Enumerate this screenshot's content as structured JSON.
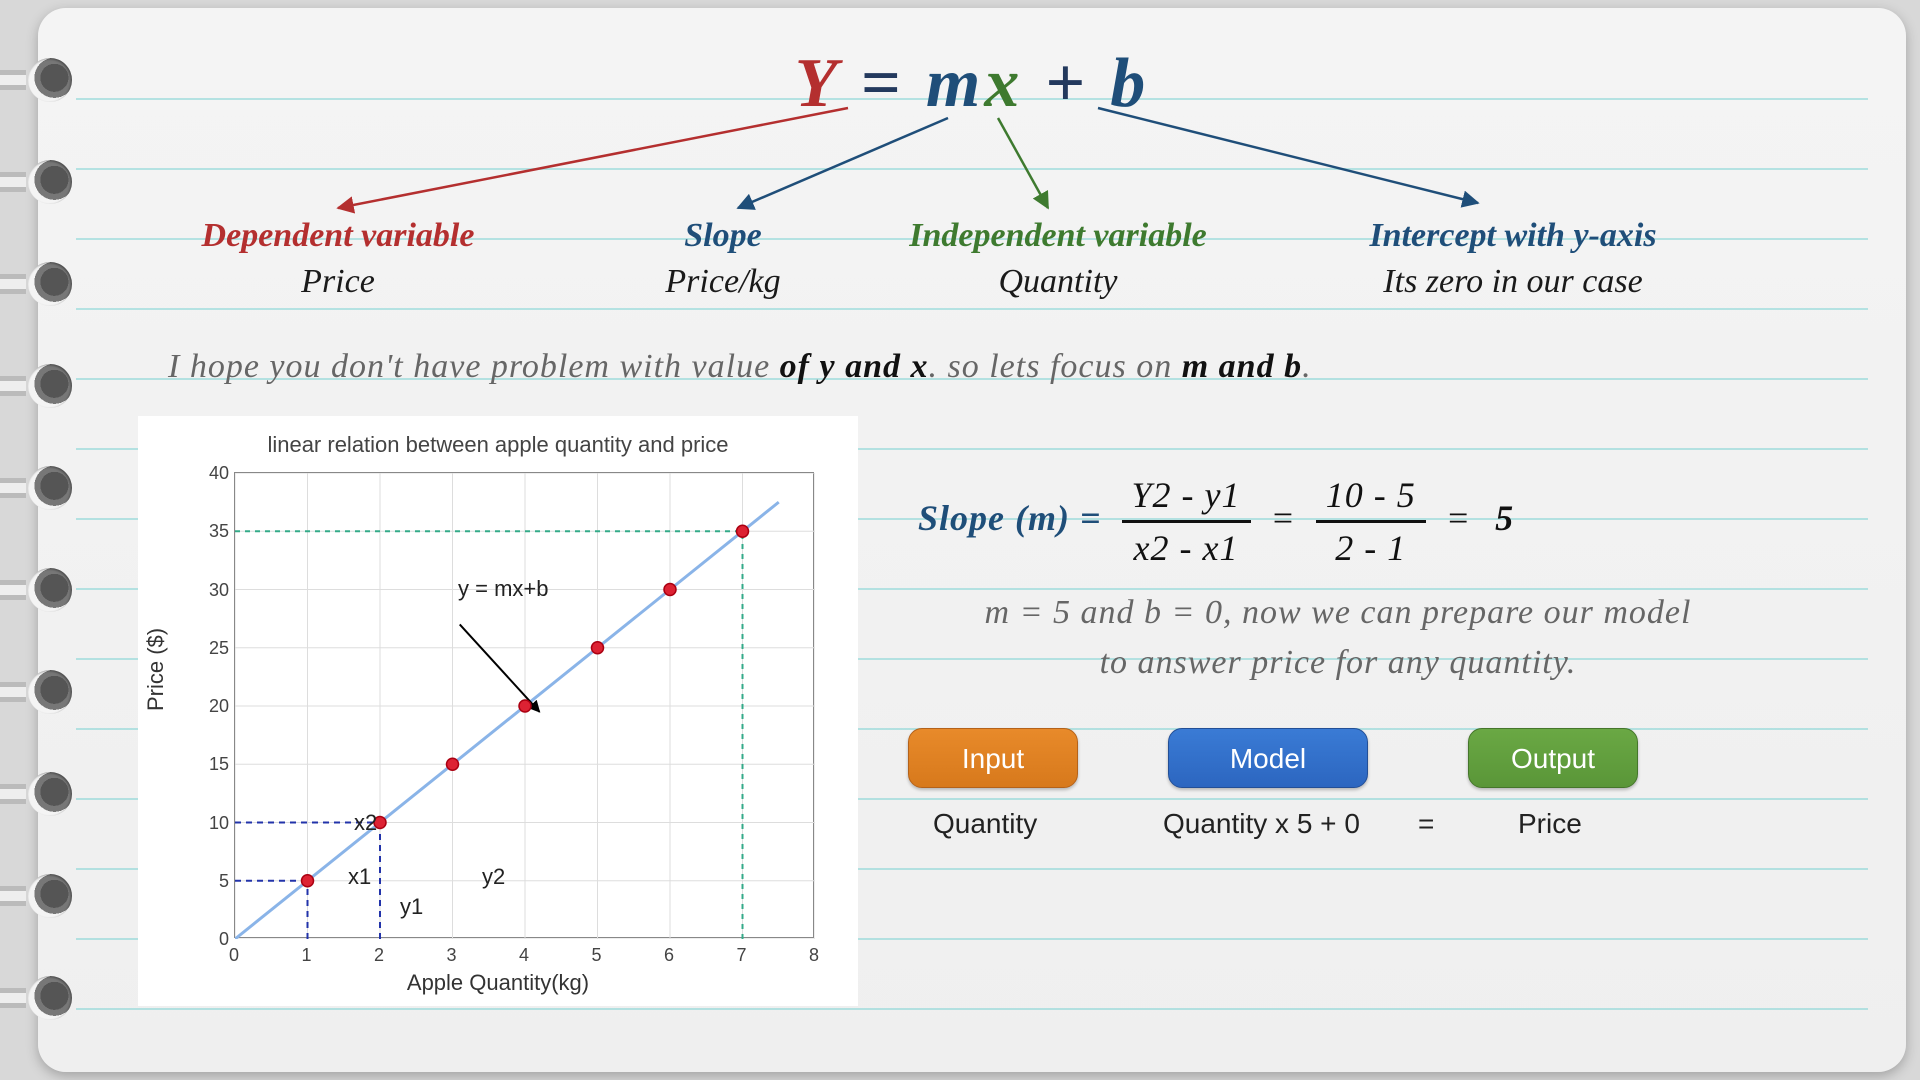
{
  "equation": {
    "y": "Y",
    "eq": " = ",
    "m": "m",
    "x": "x",
    "plus": " + ",
    "b": "b"
  },
  "definitions": {
    "dependent": {
      "title": "Dependent variable",
      "sub": "Price",
      "color": "#b42f2f"
    },
    "slope": {
      "title": "Slope",
      "sub": "Price/kg",
      "color": "#1f4e79"
    },
    "independent": {
      "title": "Independent variable",
      "sub": "Quantity",
      "color": "#3e7a2f"
    },
    "intercept": {
      "title": "Intercept with y-axis",
      "sub": "Its zero in our case",
      "color": "#1f4e79"
    }
  },
  "intro_line": {
    "pre": "I hope you don't have problem with value ",
    "em1": "of y and x",
    "mid": ". so lets focus on ",
    "em2": "m and b",
    "post": "."
  },
  "chart_data": {
    "type": "scatter-line",
    "title": "linear relation between apple quantity and price",
    "xlabel": "Apple Quantity(kg)",
    "ylabel": "Price ($)",
    "xlim": [
      0,
      8
    ],
    "ylim": [
      0,
      40
    ],
    "xticks": [
      0,
      1,
      2,
      3,
      4,
      5,
      6,
      7,
      8
    ],
    "yticks": [
      0,
      5,
      10,
      15,
      20,
      25,
      30,
      35,
      40
    ],
    "x": [
      1,
      2,
      3,
      4,
      5,
      6,
      7
    ],
    "y": [
      5,
      10,
      15,
      20,
      25,
      30,
      35
    ],
    "line_label": "y = mx+b",
    "marked": {
      "x1": 1,
      "y1": 5,
      "x2": 2,
      "y2": 10,
      "dashed_to": {
        "x": 7,
        "y": 35
      }
    },
    "ann": {
      "x1": "x1",
      "x2": "x2",
      "y1": "y1",
      "y2": "y2"
    }
  },
  "slope_formula": {
    "lhs": "Slope (m) = ",
    "num1": "Y2 - y1",
    "den1": "x2 - x1",
    "eq1": "=",
    "num2": "10 - 5",
    "den2": "2 - 1",
    "eq2": "=",
    "result": "5"
  },
  "model_line1": "m = 5 and b = 0, now we can prepare our model",
  "model_line2": "to answer price for any quantity.",
  "pills": {
    "input": "Input",
    "model": "Model",
    "output": "Output",
    "input_sub": "Quantity",
    "model_sub": "Quantity x 5 + 0",
    "eq": "=",
    "output_sub": "Price"
  }
}
